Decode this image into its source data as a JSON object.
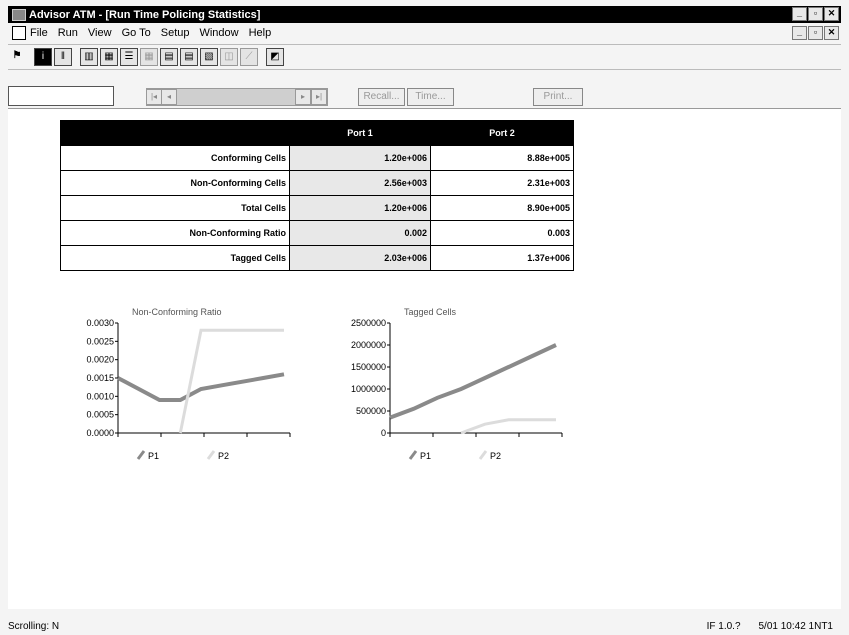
{
  "window": {
    "title": "Advisor ATM - [Run Time Policing Statistics]",
    "minimize": "_",
    "maximize": "▫",
    "close": "✕"
  },
  "menu": {
    "items": [
      "File",
      "Run",
      "View",
      "Go To",
      "Setup",
      "Window",
      "Help"
    ]
  },
  "toolbar": {
    "buttons": [
      "run",
      "info",
      "trace",
      "chart1",
      "chart2",
      "list",
      "grid",
      "table",
      "stats",
      "graph",
      "disabled1",
      "disabled2",
      "capture"
    ]
  },
  "nav": {
    "search_value": "",
    "first": "|◂",
    "prev": "◂",
    "next": "▸",
    "last": "▸|",
    "recall": "Recall...",
    "time": "Time...",
    "print": "Print..."
  },
  "table": {
    "headers": [
      "",
      "Port 1",
      "Port 2"
    ],
    "rows": [
      {
        "label": "Conforming Cells",
        "p1": "1.20e+006",
        "p2": "8.88e+005"
      },
      {
        "label": "Non-Conforming Cells",
        "p1": "2.56e+003",
        "p2": "2.31e+003"
      },
      {
        "label": "Total Cells",
        "p1": "1.20e+006",
        "p2": "8.90e+005"
      },
      {
        "label": "Non-Conforming Ratio",
        "p1": "0.002",
        "p2": "0.003"
      },
      {
        "label": "Tagged Cells",
        "p1": "2.03e+006",
        "p2": "1.37e+006"
      }
    ]
  },
  "chart_data": [
    {
      "type": "line",
      "title": "Non-Conforming Ratio",
      "ylim": [
        0,
        0.003
      ],
      "yticks": [
        "0.0030",
        "0.0025",
        "0.0020",
        "0.0015",
        "0.0010",
        "0.0005",
        "0.0000"
      ],
      "series": [
        {
          "name": "P1",
          "color": "#8a8a8a",
          "values": [
            0.0015,
            0.0012,
            0.0009,
            0.0009,
            0.0012,
            0.0013,
            0.0014,
            0.0015,
            0.0016
          ]
        },
        {
          "name": "P2",
          "color": "#dcdcdc",
          "values": [
            null,
            null,
            null,
            0,
            0.0028,
            0.0028,
            0.0028,
            0.0028,
            0.0028
          ]
        }
      ]
    },
    {
      "type": "line",
      "title": "Tagged Cells",
      "ylim": [
        0,
        2500000
      ],
      "yticks": [
        "2500000",
        "2000000",
        "1500000",
        "1000000",
        "500000",
        "0"
      ],
      "series": [
        {
          "name": "P1",
          "color": "#8a8a8a",
          "values": [
            350000,
            550000,
            800000,
            1000000,
            1250000,
            1500000,
            1750000,
            2000000
          ]
        },
        {
          "name": "P2",
          "color": "#dcdcdc",
          "values": [
            null,
            null,
            null,
            0,
            200000,
            300000,
            300000,
            300000
          ]
        }
      ]
    }
  ],
  "status": {
    "left": "Scrolling: N",
    "right1": "IF 1.0.?",
    "right2": "5/01 10:42 1NT1"
  },
  "colors": {
    "titlebar": "#000000",
    "p1": "#8a8a8a",
    "p2": "#dcdcdc"
  }
}
